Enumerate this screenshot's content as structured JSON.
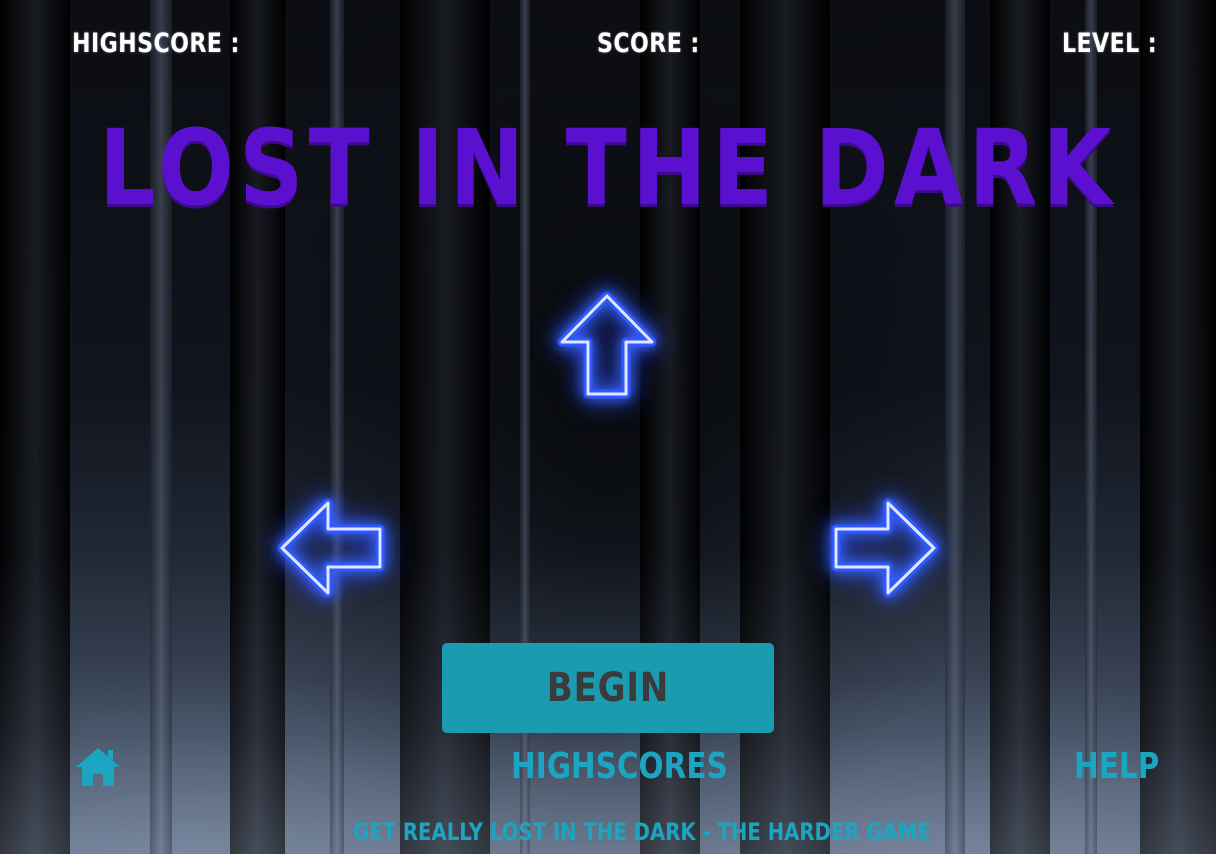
{
  "hud": {
    "highscore_label": "HIGHSCORE :",
    "score_label": "SCORE :",
    "level_label": "LEVEL :"
  },
  "title": "LOST IN THE DARK",
  "controls": {
    "up_icon": "arrow-up-icon",
    "left_icon": "arrow-left-icon",
    "right_icon": "arrow-right-icon",
    "glow_color": "#3d6bff"
  },
  "begin_label": "BEGIN",
  "nav": {
    "home_icon": "home-icon",
    "highscores_label": "HIGHSCORES",
    "help_label": "HELP"
  },
  "footer_link": "GET REALLY LOST IN THE DARK - THE HARDER GAME",
  "colors": {
    "title": "#5b10cf",
    "accent": "#1ca5c1",
    "button_bg": "#1a9bb0",
    "button_text": "#3b3b3b",
    "hud_text": "#ffffff"
  }
}
